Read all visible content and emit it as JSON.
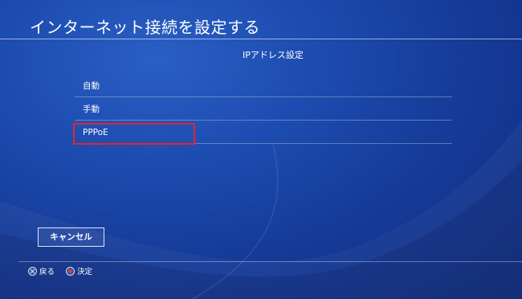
{
  "header": {
    "title": "インターネット接続を設定する"
  },
  "section": {
    "subtitle": "IPアドレス設定"
  },
  "options": [
    {
      "label": "自動"
    },
    {
      "label": "手動"
    },
    {
      "label": "PPPoE"
    }
  ],
  "cancel": {
    "label": "キャンセル"
  },
  "footer": {
    "back_label": "戻る",
    "back_icon": "cross-button-icon",
    "confirm_label": "決定",
    "confirm_icon": "circle-button-icon"
  },
  "colors": {
    "background": "#1d4cb0",
    "highlight": "#e0262f"
  }
}
